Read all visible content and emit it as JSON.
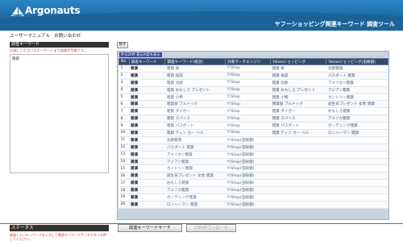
{
  "brand": {
    "logo_text": "Argonauts"
  },
  "header": {
    "title": "ヤフーショッピング関連キーワード 調査ツール"
  },
  "submenu": {
    "items": [
      "ユーザーマニュアル",
      "お問い合わせ"
    ]
  },
  "left_panel": {
    "heading": "調査キーワード",
    "note": "お調しください以キーワードまで調査が可能です。",
    "keywords_value": "雑貨"
  },
  "narrow_button": {
    "label": "探す"
  },
  "table": {
    "caption": "件全20件 表示内容を表示",
    "headers": [
      "No.",
      "調査キーワード",
      "関連キーワード(総合)",
      "対象サーチエンジン",
      "Yahooショッピング",
      "Yahooショッピング(虫眼鏡)"
    ],
    "rows": [
      {
        "no": "1",
        "kw": "雑貨",
        "rel": "雑貨 屋",
        "src": "Y!Shop",
        "y1": "雑貨 屋",
        "y2": "北欧雑貨"
      },
      {
        "no": "2",
        "kw": "雑貨",
        "rel": "雑貨 福袋",
        "src": "Y!Shop",
        "y1": "雑貨 福袋",
        "y2": "パスポート 雑貨"
      },
      {
        "no": "3",
        "kw": "雑貨",
        "rel": "雑貨 北欧",
        "src": "Y!Shop",
        "y1": "雑貨 北欧",
        "y2": "アメリカン雑貨"
      },
      {
        "no": "4",
        "kw": "雑貨",
        "rel": "雑貨 おもしろ プレゼント",
        "src": "Y!Shop",
        "y1": "雑貨 おもしろ プレゼント",
        "y2": "アジアン雑貨"
      },
      {
        "no": "5",
        "kw": "雑貨",
        "rel": "雑貨 小物",
        "src": "Y!Shop",
        "y1": "雑貨 小物",
        "y2": "カントリー雑貨"
      },
      {
        "no": "6",
        "kw": "雑貨",
        "rel": "雑貨屋 ブルドック",
        "src": "Y!Shop",
        "y1": "雑貨屋 ブルドック",
        "y2": "誕生日プレゼント 女性 雑貨"
      },
      {
        "no": "7",
        "kw": "雑貨",
        "rel": "雑貨 タイガー",
        "src": "Y!Shop",
        "y1": "雑貨 タイガー",
        "y2": "おもしろ雑貨"
      },
      {
        "no": "8",
        "kw": "雑貨",
        "rel": "雑貨 スパイス",
        "src": "Y!Shop",
        "y1": "雑貨 スパイス",
        "y2": "アメリカ雑貨"
      },
      {
        "no": "9",
        "kw": "雑貨",
        "rel": "雑貨 パスポート",
        "src": "Y!Shop",
        "y1": "雑貨 パスポート",
        "y2": "ガーデニング雑貨"
      },
      {
        "no": "10",
        "kw": "雑貨",
        "rel": "雑貨 ティン カー ベル",
        "src": "Y!Shop",
        "y1": "雑貨 ティン カー ベル",
        "y2": "ロンハーマン 雑貨"
      },
      {
        "no": "11",
        "kw": "雑貨",
        "rel": "北欧雑貨",
        "src": "Y!Shop(虫眼鏡)",
        "y1": "",
        "y2": ""
      },
      {
        "no": "12",
        "kw": "雑貨",
        "rel": "パスポート 雑貨",
        "src": "Y!Shop(虫眼鏡)",
        "y1": "",
        "y2": ""
      },
      {
        "no": "13",
        "kw": "雑貨",
        "rel": "アメリカン雑貨",
        "src": "Y!Shop(虫眼鏡)",
        "y1": "",
        "y2": ""
      },
      {
        "no": "14",
        "kw": "雑貨",
        "rel": "アジアン雑貨",
        "src": "Y!Shop(虫眼鏡)",
        "y1": "",
        "y2": ""
      },
      {
        "no": "15",
        "kw": "雑貨",
        "rel": "カントリー雑貨",
        "src": "Y!Shop(虫眼鏡)",
        "y1": "",
        "y2": ""
      },
      {
        "no": "16",
        "kw": "雑貨",
        "rel": "誕生日プレゼント 女性 雑貨",
        "src": "Y!Shop(虫眼鏡)",
        "y1": "",
        "y2": ""
      },
      {
        "no": "17",
        "kw": "雑貨",
        "rel": "おもしろ雑貨",
        "src": "Y!Shop(虫眼鏡)",
        "y1": "",
        "y2": ""
      },
      {
        "no": "18",
        "kw": "雑貨",
        "rel": "アメリカ雑貨",
        "src": "Y!Shop(虫眼鏡)",
        "y1": "",
        "y2": ""
      },
      {
        "no": "19",
        "kw": "雑貨",
        "rel": "ガーデニング雑貨",
        "src": "Y!Shop(虫眼鏡)",
        "y1": "",
        "y2": ""
      },
      {
        "no": "20",
        "kw": "雑貨",
        "rel": "ロンハーマン 雑貨",
        "src": "Y!Shop(虫眼鏡)",
        "y1": "",
        "y2": ""
      }
    ]
  },
  "status": {
    "heading": "ステータス",
    "message": "調査したいキーワードを入力して関連キーワードサーチボタンを押してください。"
  },
  "buttons": {
    "search": "関連キーワードサーチ",
    "csv": "CSVダウンロード"
  },
  "colors": {
    "header_blue": "#1f6fa6",
    "table_header": "#344a6b",
    "accent_red": "#d23b3b"
  }
}
